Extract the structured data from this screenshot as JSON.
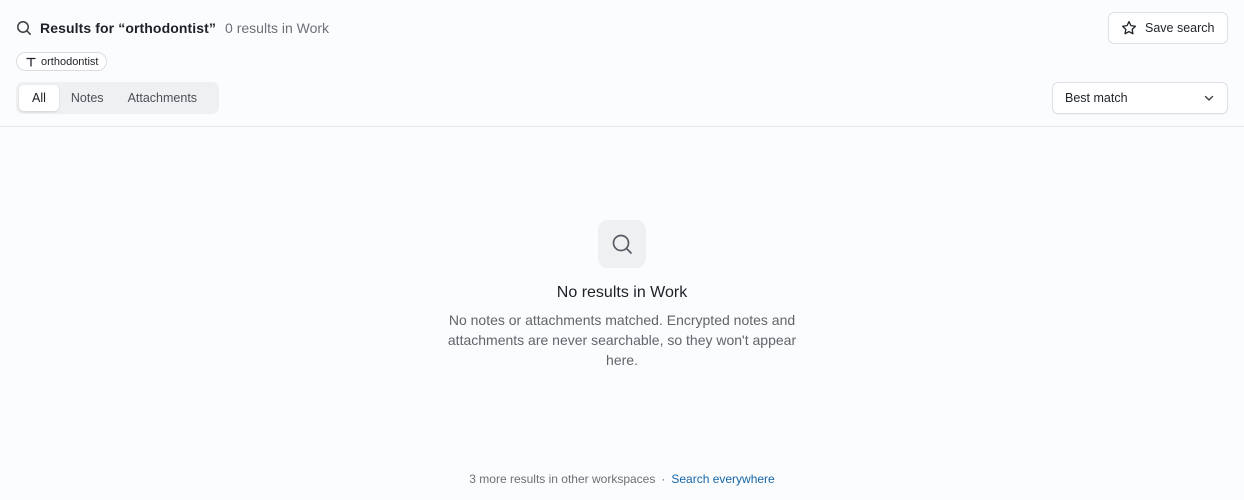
{
  "header": {
    "title": "Results for “orthodontist”",
    "count": "0 results in Work",
    "save_label": "Save search"
  },
  "chip": {
    "label": "orthodontist",
    "icon": "text-icon"
  },
  "tabs": [
    {
      "label": "All",
      "active": true
    },
    {
      "label": "Notes",
      "active": false
    },
    {
      "label": "Attachments",
      "active": false
    }
  ],
  "sort": {
    "value": "Best match"
  },
  "empty": {
    "icon": "search-icon",
    "title": "No results in Work",
    "description": "No notes or attachments matched. Encrypted notes and attachments are never searchable, so they won't appear here."
  },
  "footer": {
    "text": "3 more results in other workspaces",
    "separator": "·",
    "link": "Search everywhere"
  },
  "colors": {
    "link": "#1766a8",
    "background": "#fbfcfd"
  }
}
